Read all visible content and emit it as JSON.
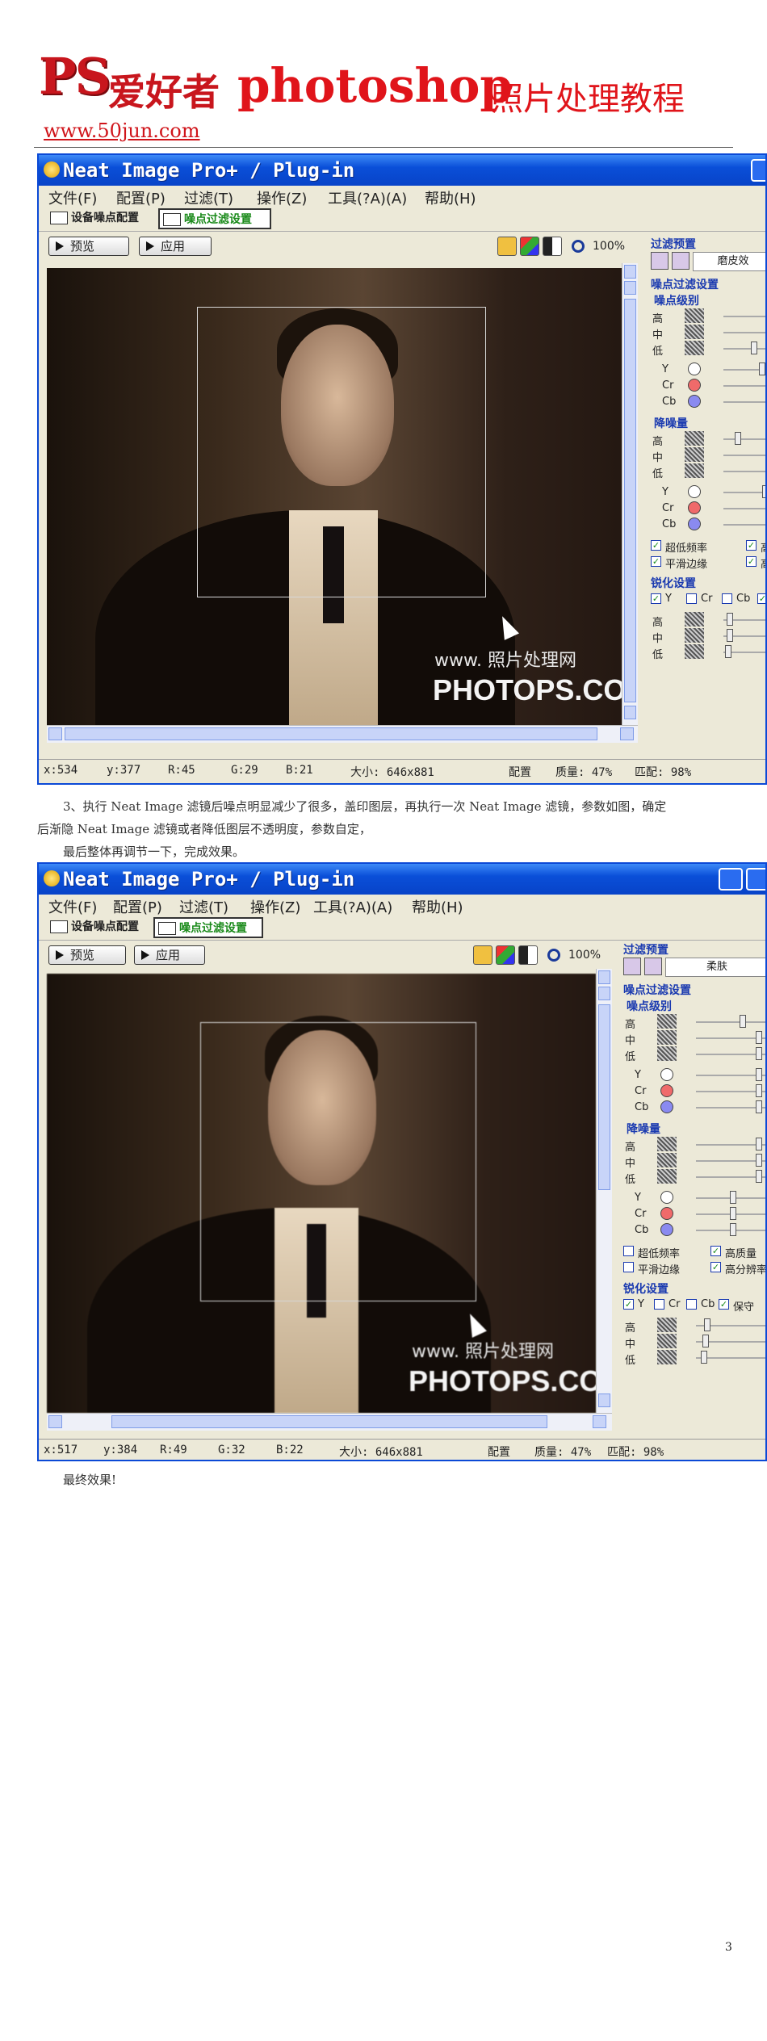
{
  "header": {
    "logo_ps": "PS",
    "logo_cn": "爱好者",
    "title_en": "photoshop",
    "title_cn": "照片处理教程",
    "site": "www.50jun.com"
  },
  "window1": {
    "title": "Neat Image Pro+ / Plug-in",
    "menu": [
      "文件(F)",
      "配置(P)",
      "过滤(T)",
      "操作(Z)",
      "工具(?A)(A)",
      "帮助(H)"
    ],
    "tabs": [
      "设备噪点配置",
      "噪点过滤设置"
    ],
    "preview_label": "预览",
    "apply_label": "应用",
    "zoom": "100%",
    "watermark_small": "www.    照片处理网",
    "watermark_big": "PHOTOPS.COM",
    "panel": {
      "preset_title": "过滤预置",
      "preset_value": "磨皮效",
      "filter_title": "噪点过滤设置",
      "level_title": "噪点级别",
      "reduce_title": "降噪量",
      "sharpen_title": "锐化设置",
      "high": "高",
      "mid": "中",
      "low": "低",
      "y": "Y",
      "cr": "Cr",
      "cb": "Cb",
      "chk_ultra_low": "超低频率",
      "chk_smooth_edges": "平滑边缘",
      "chk_high": "高",
      "chk_high2": "高"
    },
    "status": {
      "x": "x:534",
      "y": "y:377",
      "r": "R:45",
      "g": "G:29",
      "b": "B:21",
      "size": "大小: 646x881",
      "config": "配置",
      "quality": "质量: 47%",
      "match": "匹配: 98%"
    }
  },
  "paragraph1_line1": "3、执行 Neat Image 滤镜后噪点明显减少了很多，盖印图层，再执行一次 Neat Image 滤镜，参数如图，确定",
  "paragraph1_line2": "后渐隐 Neat Image 滤镜或者降低图层不透明度，参数自定，",
  "paragraph2": "最后整体再调节一下，完成效果。",
  "window2": {
    "title": "Neat Image Pro+ / Plug-in",
    "menu": [
      "文件(F)",
      "配置(P)",
      "过滤(T)",
      "操作(Z)",
      "工具(?A)(A)",
      "帮助(H)"
    ],
    "tabs": [
      "设备噪点配置",
      "噪点过滤设置"
    ],
    "preview_label": "预览",
    "apply_label": "应用",
    "zoom": "100%",
    "watermark_small": "www.    照片处理网",
    "watermark_big": "PHOTOPS.COM",
    "panel": {
      "preset_title": "过滤预置",
      "preset_value": "柔肤",
      "filter_title": "噪点过滤设置",
      "level_title": "噪点级别",
      "reduce_title": "降噪量",
      "sharpen_title": "锐化设置",
      "high": "高",
      "mid": "中",
      "low": "低",
      "y": "Y",
      "cr": "Cr",
      "cb": "Cb",
      "chk_ultra_low": "超低频率",
      "chk_smooth_edges": "平滑边缘",
      "chk_high_quality": "高质量",
      "chk_high_res": "高分辨率",
      "chk_keep": "保守"
    },
    "status": {
      "x": "x:517",
      "y": "y:384",
      "r": "R:49",
      "g": "G:32",
      "b": "B:22",
      "size": "大小: 646x881",
      "config": "配置",
      "quality": "质量: 47%",
      "match": "匹配: 98%"
    }
  },
  "final_caption": "最终效果!",
  "page_number": "3"
}
